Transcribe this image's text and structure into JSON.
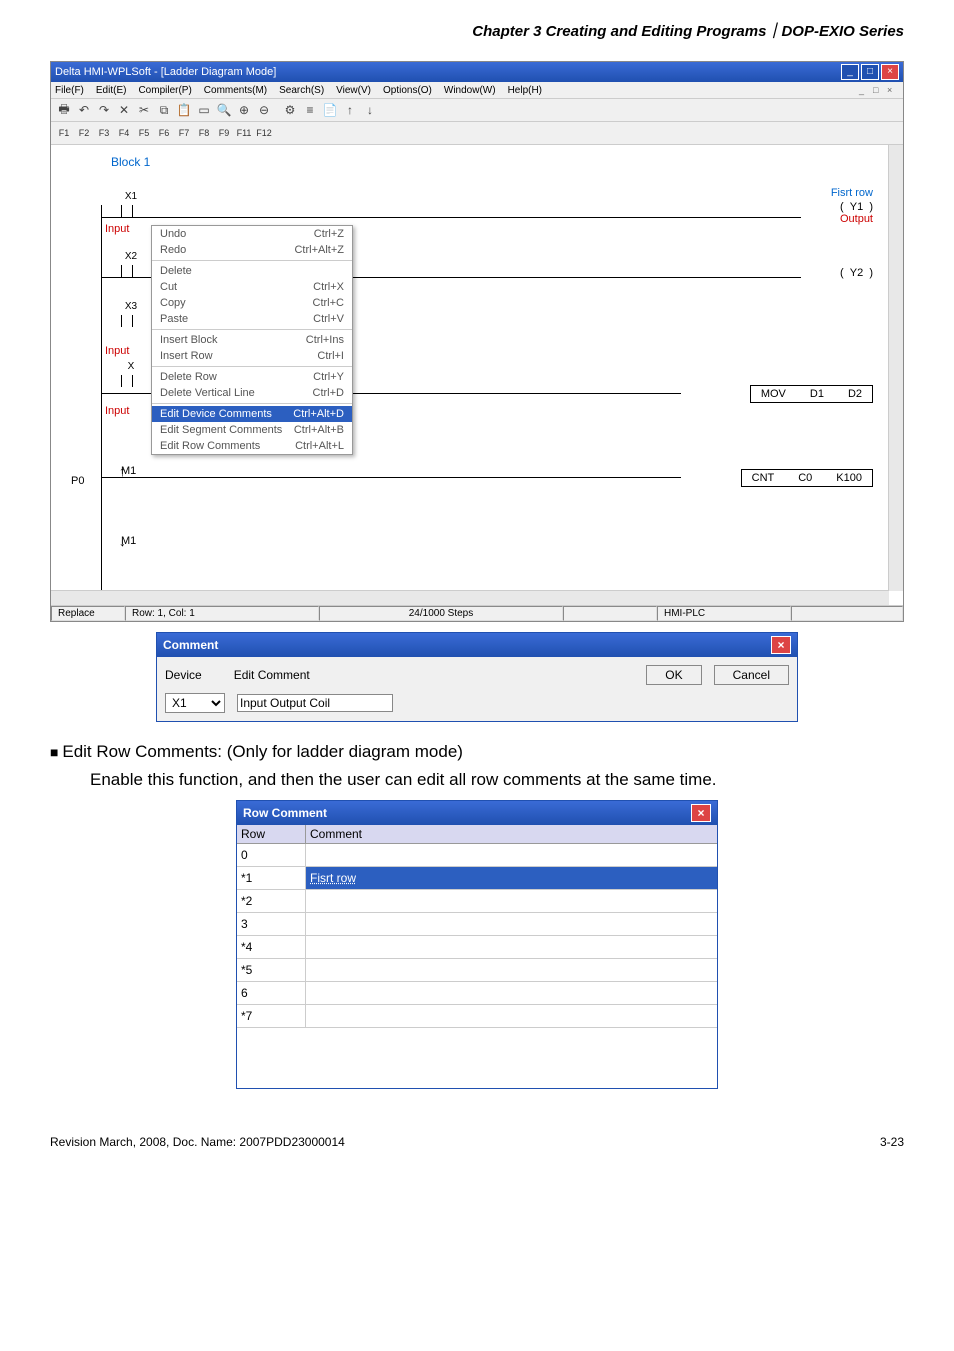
{
  "page_header": "Chapter 3 Creating and Editing Programs｜DOP-EXIO Series",
  "app": {
    "title": "Delta HMI-WPLSoft - [Ladder Diagram Mode]",
    "menu": [
      "File(F)",
      "Edit(E)",
      "Compiler(P)",
      "Comments(M)",
      "Search(S)",
      "View(V)",
      "Options(O)",
      "Window(W)",
      "Help(H)"
    ],
    "fkeys": [
      "F1",
      "F2",
      "F3",
      "F4",
      "F5",
      "F6",
      "F7",
      "F8",
      "F9",
      "F11",
      "F12"
    ],
    "block": "Block 1",
    "fisrt_row": "Fisrt row",
    "contacts": {
      "x1": "X1",
      "x2": "X2",
      "x3": "X3",
      "input": "Input",
      "y1": "Y1",
      "y2": "Y2",
      "output": "Output",
      "m1": "M1",
      "p0": "P0"
    },
    "instructions": {
      "mov": {
        "op": "MOV",
        "a": "D1",
        "b": "D2"
      },
      "cnt": {
        "op": "CNT",
        "a": "C0",
        "b": "K100"
      }
    },
    "context_menu": [
      {
        "label": "Undo",
        "shortcut": "Ctrl+Z"
      },
      {
        "label": "Redo",
        "shortcut": "Ctrl+Alt+Z"
      },
      {
        "sep": true
      },
      {
        "label": "Delete",
        "shortcut": ""
      },
      {
        "label": "Cut",
        "shortcut": "Ctrl+X"
      },
      {
        "label": "Copy",
        "shortcut": "Ctrl+C"
      },
      {
        "label": "Paste",
        "shortcut": "Ctrl+V"
      },
      {
        "sep": true
      },
      {
        "label": "Insert Block",
        "shortcut": "Ctrl+Ins"
      },
      {
        "label": "Insert Row",
        "shortcut": "Ctrl+I"
      },
      {
        "sep": true
      },
      {
        "label": "Delete Row",
        "shortcut": "Ctrl+Y"
      },
      {
        "label": "Delete Vertical Line",
        "shortcut": "Ctrl+D"
      },
      {
        "sep": true
      },
      {
        "label": "Edit Device Comments",
        "shortcut": "Ctrl+Alt+D",
        "sel": true
      },
      {
        "label": "Edit Segment Comments",
        "shortcut": "Ctrl+Alt+B"
      },
      {
        "label": "Edit Row Comments",
        "shortcut": "Ctrl+Alt+L"
      }
    ],
    "status": {
      "mode": "Replace",
      "pos": "Row: 1, Col: 1",
      "steps": "24/1000 Steps",
      "device": "HMI-PLC"
    }
  },
  "comment_dialog": {
    "title": "Comment",
    "device_label": "Device",
    "device_value": "X1",
    "edit_label": "Edit Comment",
    "edit_value": "Input Output Coil",
    "ok": "OK",
    "cancel": "Cancel"
  },
  "section": {
    "heading": "Edit Row Comments: (Only for ladder diagram mode)",
    "body": "Enable this function, and then the user can edit all row comments at the same time."
  },
  "row_comment": {
    "title": "Row Comment",
    "col1": "Row",
    "col2": "Comment",
    "rows": [
      {
        "n": "0",
        "c": ""
      },
      {
        "n": "*1",
        "c": "Fisrt row",
        "sel": true
      },
      {
        "n": "*2",
        "c": ""
      },
      {
        "n": "3",
        "c": ""
      },
      {
        "n": "*4",
        "c": ""
      },
      {
        "n": "*5",
        "c": ""
      },
      {
        "n": "6",
        "c": ""
      },
      {
        "n": "*7",
        "c": ""
      }
    ]
  },
  "footer": {
    "left": "Revision March, 2008, Doc. Name: 2007PDD23000014",
    "right": "3-23"
  }
}
